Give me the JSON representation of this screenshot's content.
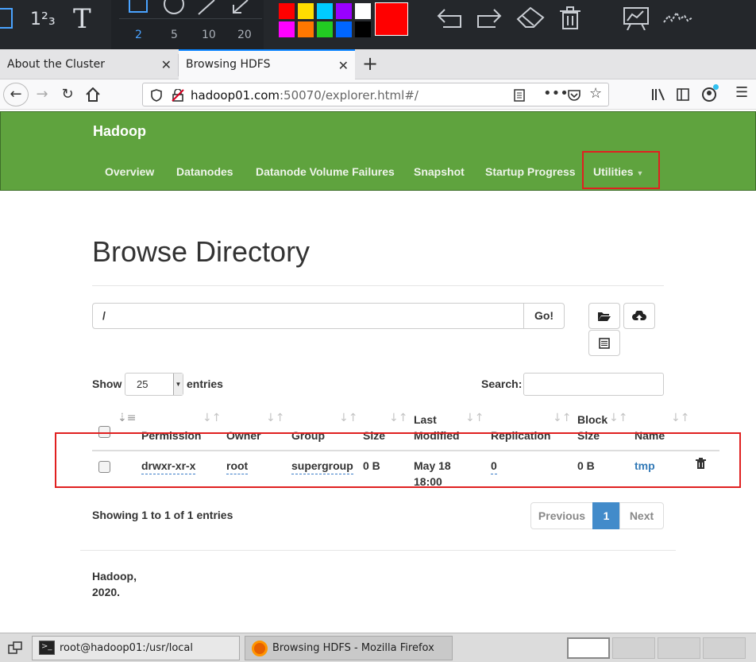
{
  "annotation_toolbar": {
    "stroke_sizes": [
      "2",
      "5",
      "10",
      "20"
    ],
    "colors": [
      "#ff0000",
      "#ffdd00",
      "#00ccff",
      "#9900ff",
      "#ffffff",
      "#ff00ff",
      "#ff7700",
      "#22cc22",
      "#0066ff",
      "#000000"
    ],
    "current_color": "#ff0000",
    "number_tool_label": "1²₃",
    "text_tool_label": "T"
  },
  "browser": {
    "tabs": [
      {
        "label": "About the Cluster"
      },
      {
        "label": "Browsing HDFS"
      }
    ],
    "url_host": "hadoop01.com",
    "url_rest": ":50070/explorer.html#/"
  },
  "hadoop": {
    "brand": "Hadoop",
    "nav": [
      "Overview",
      "Datanodes",
      "Datanode Volume Failures",
      "Snapshot",
      "Startup Progress",
      "Utilities"
    ],
    "accent": "#5fa33e"
  },
  "page": {
    "title": "Browse Directory",
    "path_value": "/",
    "go_label": "Go!",
    "show_label": "Show",
    "entries_value": "25",
    "entries_label": "entries",
    "search_label": "Search:",
    "columns": [
      "Permission",
      "Owner",
      "Group",
      "Size",
      "Last",
      "Modified",
      "Replication",
      "Block",
      "Size",
      "Name"
    ],
    "row": {
      "permission": "drwxr-xr-x",
      "owner": "root",
      "group": "supergroup",
      "size": "0 B",
      "modified_1": "May 18",
      "modified_2": "18:00",
      "replication": "0",
      "block_size": "0 B",
      "name": "tmp"
    },
    "showing": "Showing 1 to 1 of 1 entries",
    "pager": {
      "prev": "Previous",
      "current": "1",
      "next": "Next"
    },
    "footer_1": "Hadoop,",
    "footer_2": "2020."
  },
  "taskbar": {
    "terminal": "root@hadoop01:/usr/local",
    "firefox": "Browsing HDFS - Mozilla Firefox"
  }
}
